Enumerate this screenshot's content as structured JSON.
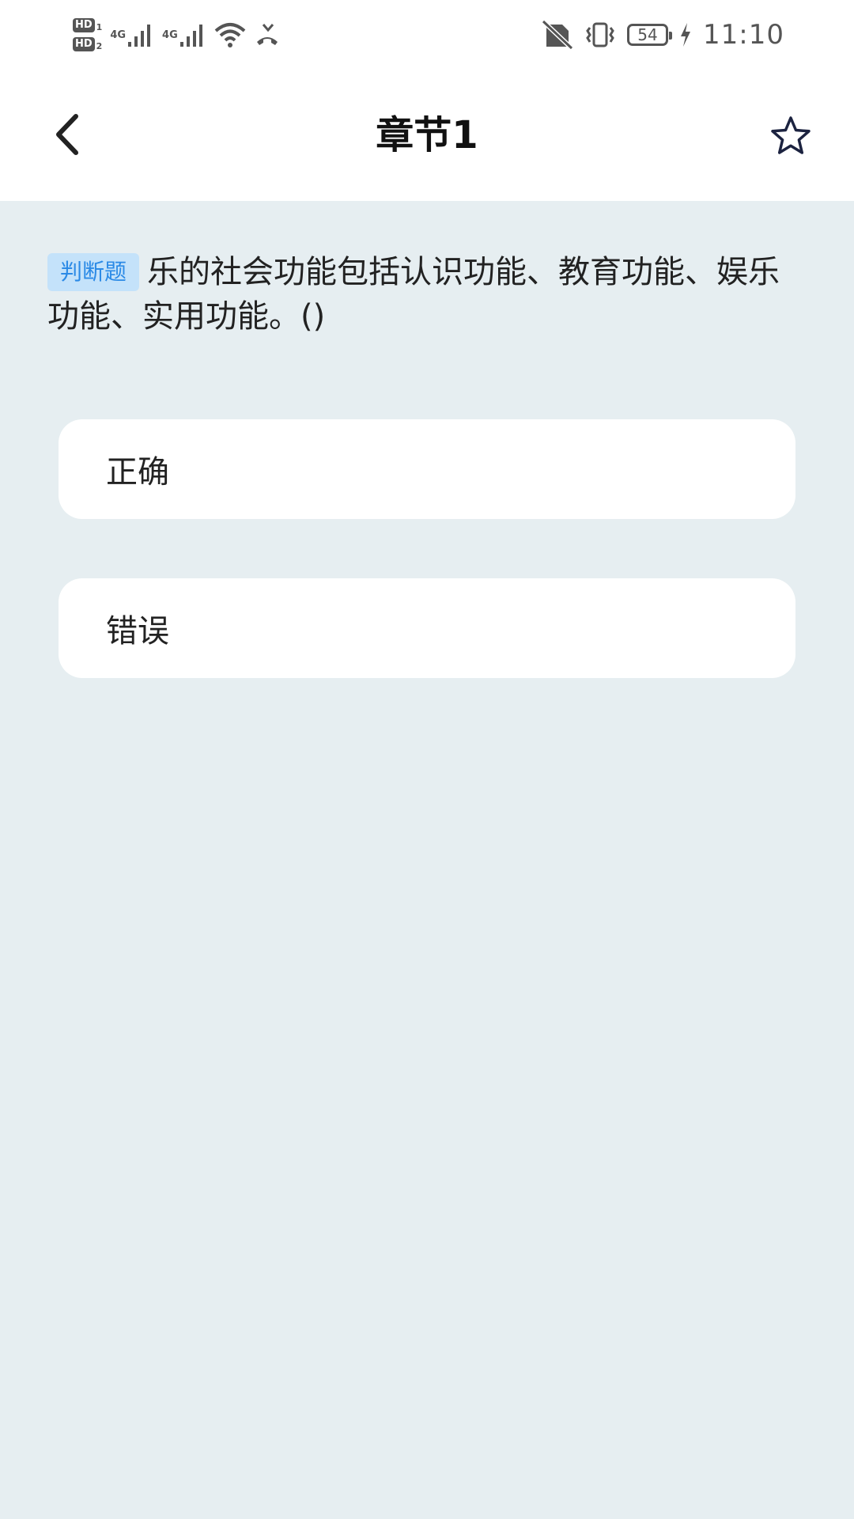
{
  "status_bar": {
    "hd1": "HD",
    "hd1_sub": "1",
    "hd2": "HD",
    "hd2_sub": "2",
    "sim1_net": "4G",
    "sim2_net": "4G",
    "battery_level": "54",
    "time": "11:10",
    "icons": [
      "hd-icon",
      "signal-icon",
      "wifi-icon",
      "missed-call-icon",
      "no-sim-icon",
      "vibrate-icon",
      "battery-icon",
      "charging-icon"
    ]
  },
  "header": {
    "title": "章节1",
    "back_icon": "chevron-left-icon",
    "favorite_icon": "star-outline-icon"
  },
  "question": {
    "type_label": "判断题",
    "text": "乐的社会功能包括认识功能、教育功能、娱乐功能、实用功能。()"
  },
  "options": [
    {
      "label": "正确"
    },
    {
      "label": "错误"
    }
  ],
  "colors": {
    "background": "#e6eef1",
    "badge_bg": "#c4e2fa",
    "badge_text": "#2b8ae6",
    "card": "#ffffff"
  }
}
